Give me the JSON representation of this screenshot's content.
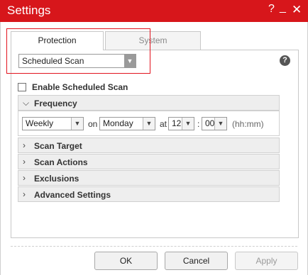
{
  "window": {
    "title": "Settings",
    "help_glyph": "?",
    "minimize_glyph": "_",
    "close_glyph": "✕"
  },
  "tabs": [
    {
      "label": "Protection",
      "active": true
    },
    {
      "label": "System",
      "active": false
    }
  ],
  "scan_selector": {
    "value": "Scheduled Scan"
  },
  "help_icon_glyph": "?",
  "enable_scheduled_scan": {
    "label": "Enable Scheduled Scan",
    "checked": false
  },
  "sections": {
    "frequency": "Frequency",
    "scan_target": "Scan Target",
    "scan_actions": "Scan Actions",
    "exclusions": "Exclusions",
    "advanced_settings": "Advanced Settings"
  },
  "frequency": {
    "period": "Weekly",
    "on_label": "on",
    "day": "Monday",
    "at_label": "at",
    "hour": "12",
    "colon": ":",
    "minute": "00",
    "format_hint": "(hh:mm)"
  },
  "buttons": {
    "ok": "OK",
    "cancel": "Cancel",
    "apply": "Apply"
  },
  "colors": {
    "titlebar": "#d7161b",
    "highlight": "#e2131e"
  }
}
